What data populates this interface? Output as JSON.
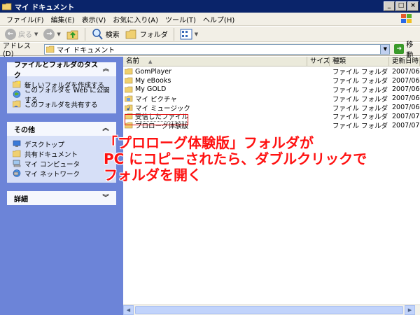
{
  "window": {
    "title": "マイ ドキュメント",
    "buttons": [
      "_",
      "□",
      "×"
    ]
  },
  "menu": [
    "ファイル(F)",
    "編集(E)",
    "表示(V)",
    "お気に入り(A)",
    "ツール(T)",
    "ヘルプ(H)"
  ],
  "toolbar": {
    "back": "戻る",
    "search": "検索",
    "folders": "フォルダ"
  },
  "address": {
    "label": "アドレス(D)",
    "value": "マイ ドキュメント",
    "go": "移動"
  },
  "tasks": {
    "file_folder": {
      "title": "ファイルとフォルダのタスク",
      "items": [
        "新しいフォルダを作成する",
        "このフォルダを Web に公開する",
        "このフォルダを共有する"
      ]
    },
    "other": {
      "title": "その他",
      "items": [
        "デスクトップ",
        "共有ドキュメント",
        "マイ コンピュータ",
        "マイ ネットワーク"
      ]
    },
    "details": {
      "title": "詳細"
    }
  },
  "columns": {
    "name": "名前",
    "size": "サイズ",
    "type": "種類",
    "date": "更新日時"
  },
  "files": [
    {
      "name": "GomPlayer",
      "type": "ファイル フォルダ",
      "date": "2007/06"
    },
    {
      "name": "My eBooks",
      "type": "ファイル フォルダ",
      "date": "2007/06"
    },
    {
      "name": "My GOLD",
      "type": "ファイル フォルダ",
      "date": "2007/06"
    },
    {
      "name": "マイ ピクチャ",
      "type": "ファイル フォルダ",
      "date": "2007/06"
    },
    {
      "name": "マイ ミュージック",
      "type": "ファイル フォルダ",
      "date": "2007/06"
    },
    {
      "name": "受信したファイル",
      "type": "ファイル フォルダ",
      "date": "2007/07"
    },
    {
      "name": "プロローグ体験版",
      "type": "ファイル フォルダ",
      "date": "2007/07"
    }
  ],
  "annotation": {
    "line1": "「プロローグ体験版」フォルダが",
    "line2": "PC にコピーされたら、ダブルクリックで",
    "line3": "フォルダを開く"
  },
  "colors": {
    "annotation": "#ff1010",
    "highlight": "#e01010",
    "left_pane": "#6c84d8"
  }
}
